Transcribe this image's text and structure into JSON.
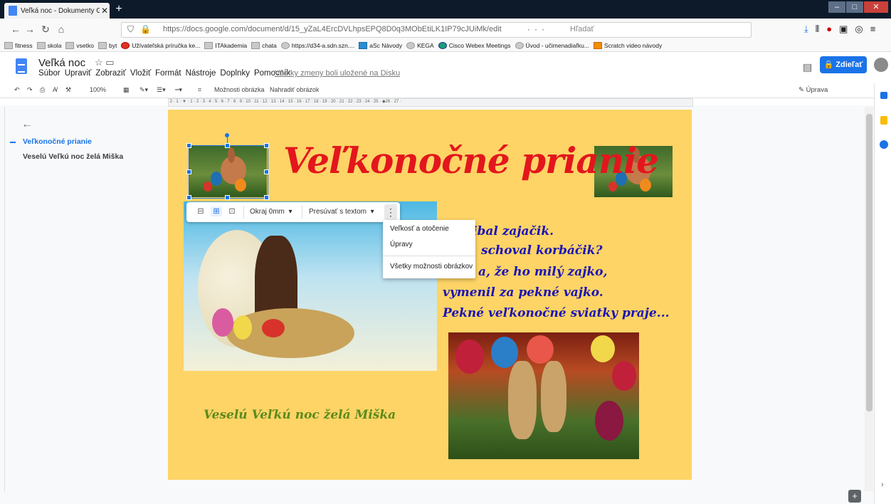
{
  "browser": {
    "tab_title": "Veľká noc - Dokumenty Google",
    "tab_close": "✕",
    "new_tab": "+",
    "url": "https://docs.google.com/document/d/15_yZaL4ErcDVLhpsEPQ8D0q3MObEtiLK1IP79cJUiMk/edit",
    "search_placeholder": "Hľadať",
    "more_actions": "···",
    "bookmarks": [
      "fitness",
      "skola",
      "vsetko",
      "byt",
      "Užívateľská príručka ke...",
      "ITAkademia",
      "chata",
      "https://d34-a.sdn.szn....",
      "aSc Návody",
      "KEGA",
      "Cisco Webex Meetings",
      "Úvod - učimenadiaľku...",
      "Scratch video návody"
    ]
  },
  "doc": {
    "title": "Veľká noc",
    "menu": [
      "Súbor",
      "Upraviť",
      "Zobraziť",
      "Vložiť",
      "Formát",
      "Nástroje",
      "Doplnky",
      "Pomocník"
    ],
    "saved_status": "Všetky zmeny boli uložené na Disku",
    "share_label": "Zdieľať",
    "toolbar": {
      "zoom": "100%",
      "image_options": "Možnosti obrázka",
      "replace_image": "Nahradiť obrázok",
      "edit_mode": "Úprava"
    }
  },
  "outline": {
    "items": [
      "Veľkonočné prianie",
      "Veselú Veľkú noc želá Miška"
    ]
  },
  "page": {
    "heading": "Veľkonočné prianie",
    "poem": [
      "ibal zajačik.",
      "schoval korbáčik?",
      "a, že ho milý zajko,",
      "vymenil za pekné vajko.",
      "Pekné veľkonočné sviatky praje..."
    ],
    "signature": "Veselú Veľkú noc želá Miška"
  },
  "image_toolbar": {
    "margin": "Okraj 0mm",
    "move_with_text": "Presúvať s textom"
  },
  "context_menu": {
    "items": [
      "Veľkosť a otočenie",
      "Úpravy",
      "Všetky možnosti obrázkov"
    ]
  },
  "colors": {
    "page_bg": "#fdd465",
    "heading": "#e3161d",
    "poem": "#1c13b8",
    "signature": "#5c8a1c",
    "accent": "#1a73e8"
  }
}
